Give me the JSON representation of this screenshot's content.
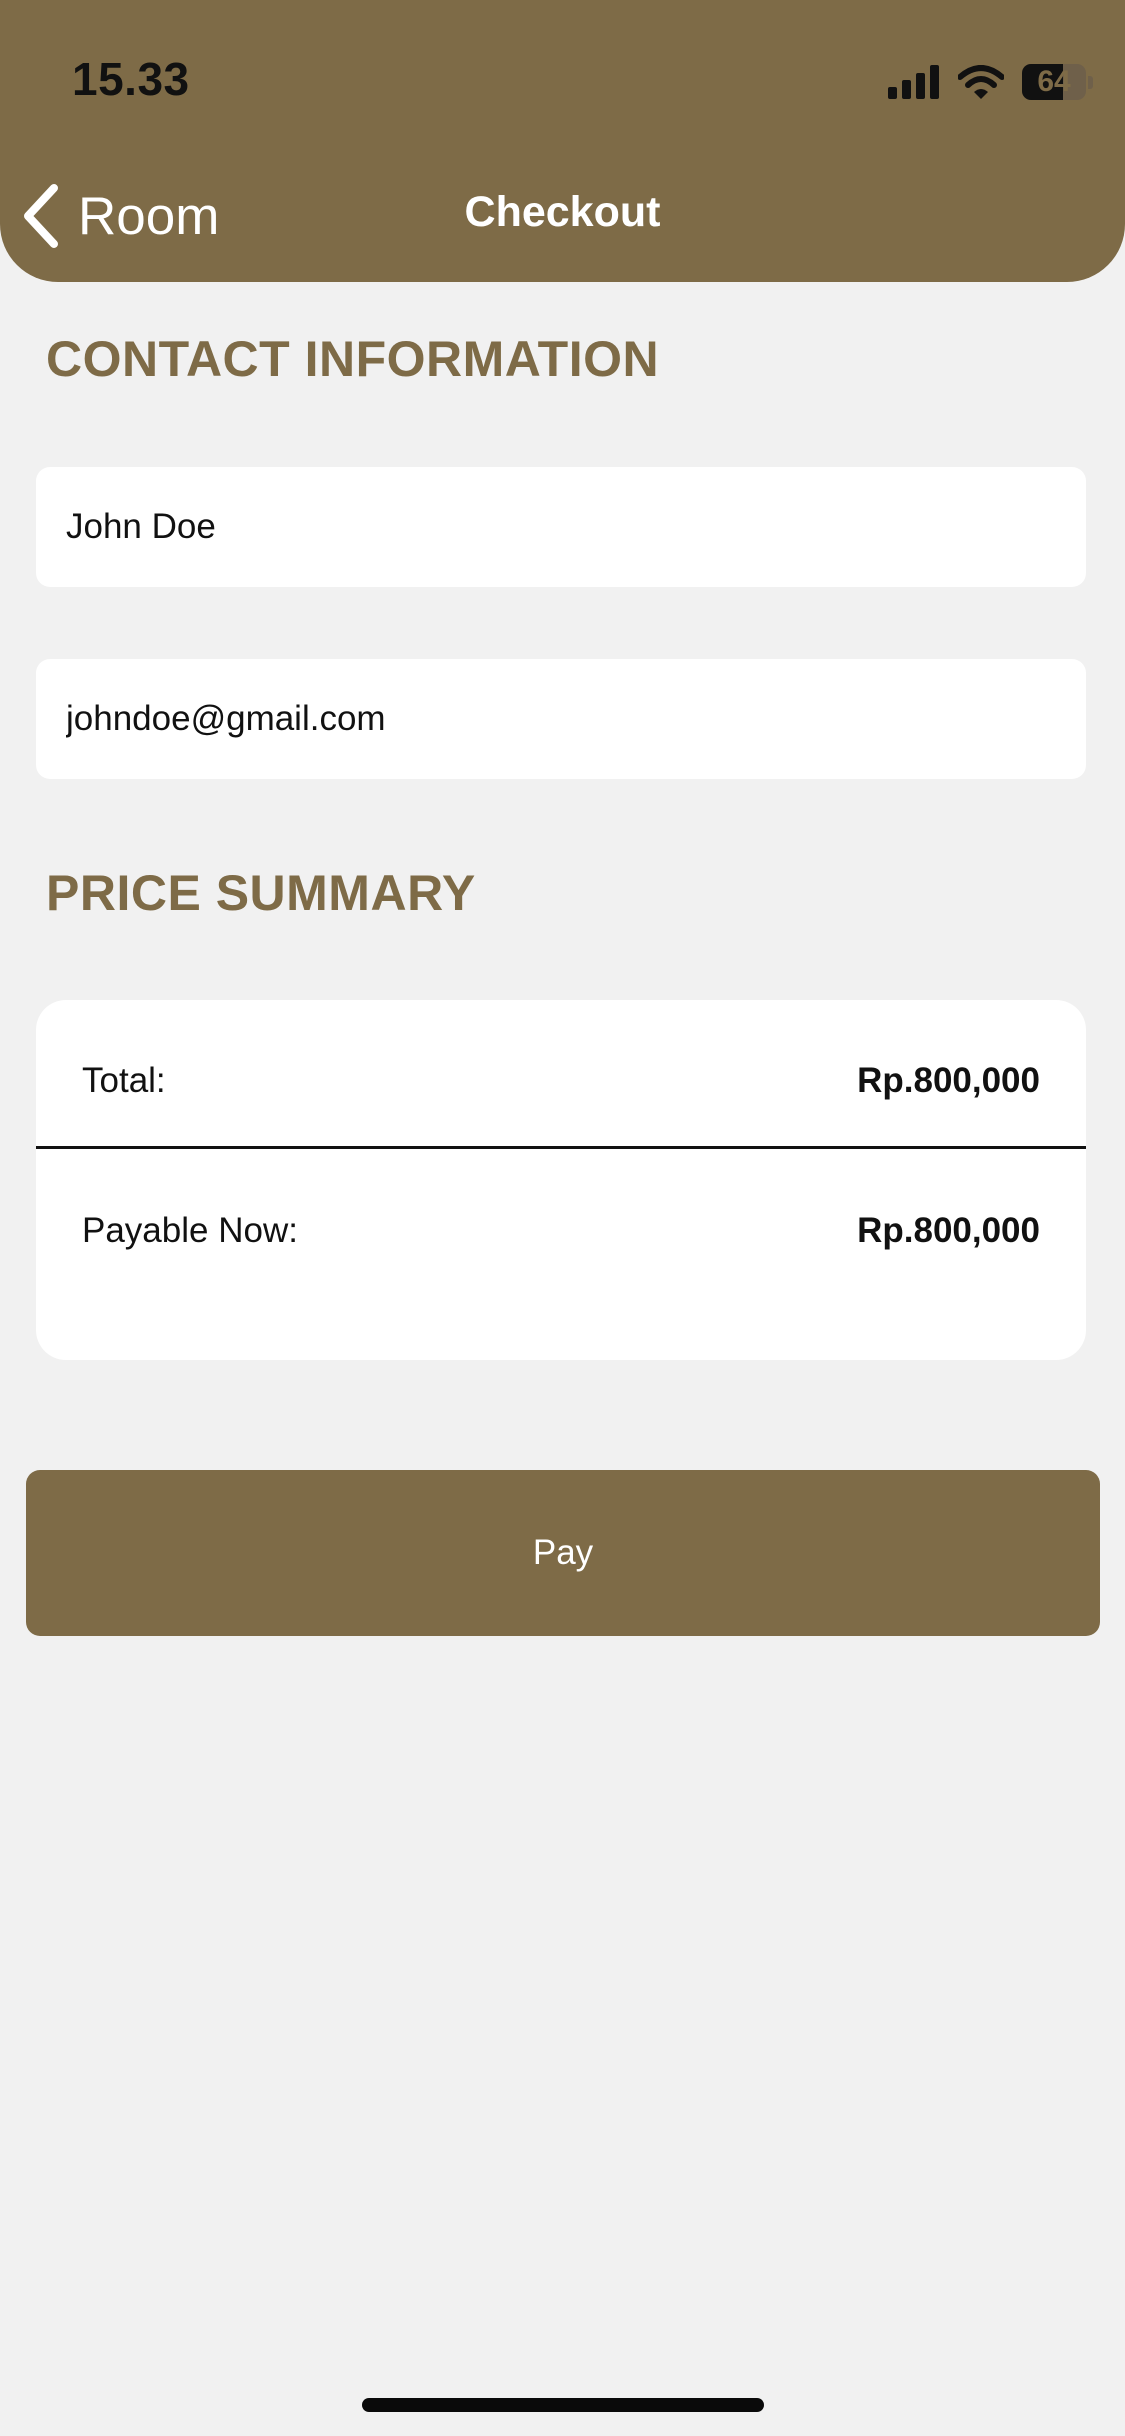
{
  "status_bar": {
    "time": "15.33",
    "battery_level": "64",
    "battery_fraction": 0.64,
    "icons": [
      "signal-icon",
      "wifi-icon",
      "battery-icon"
    ]
  },
  "nav": {
    "back_label": "Room",
    "back_icon": "chevron-left-icon",
    "title": "Checkout"
  },
  "contact": {
    "heading": "CONTACT INFORMATION",
    "name_value": "John Doe",
    "email_value": "johndoe@gmail.com"
  },
  "price_summary": {
    "heading": "PRICE SUMMARY",
    "rows": [
      {
        "label": "Total:",
        "value": "Rp.800,000"
      },
      {
        "label": "Payable Now:",
        "value": "Rp.800,000"
      }
    ]
  },
  "actions": {
    "pay_label": "Pay"
  },
  "colors": {
    "accent": "#7e6b47",
    "background": "#f1f1f1",
    "card": "#ffffff",
    "text": "#111111"
  }
}
